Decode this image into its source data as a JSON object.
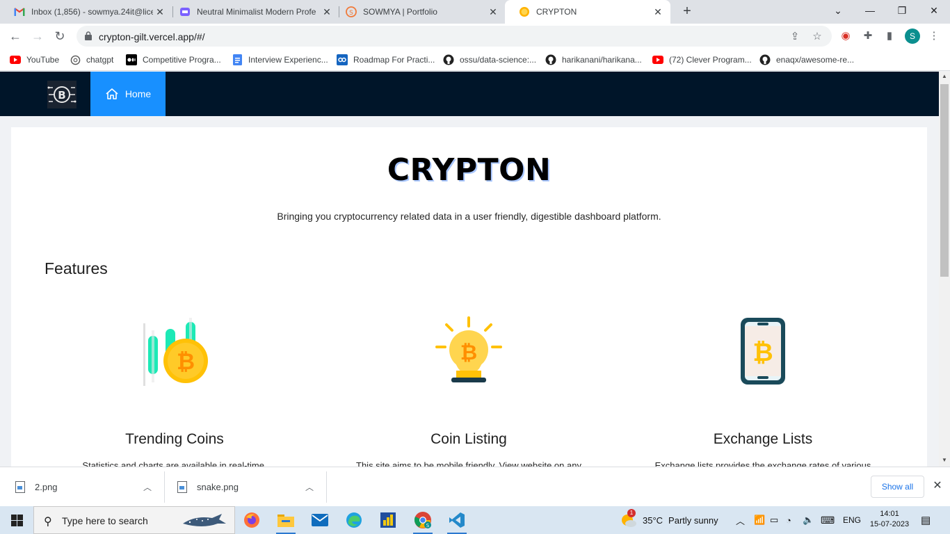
{
  "browser": {
    "tabs": [
      {
        "title": "Inbox (1,856) - sowmya.24it@lice",
        "icon": "gmail-icon",
        "active": false
      },
      {
        "title": "Neutral Minimalist Modern Profe",
        "icon": "document-icon",
        "active": false
      },
      {
        "title": "SOWMYA | Portfolio",
        "icon": "portfolio-icon",
        "active": false
      },
      {
        "title": "CRYPTON",
        "icon": "coin-icon",
        "active": true
      }
    ],
    "url": "crypton-gilt.vercel.app/#/",
    "profile_initial": "S",
    "bookmarks": [
      {
        "label": "YouTube",
        "icon": "youtube-icon"
      },
      {
        "label": "chatgpt",
        "icon": "openai-icon"
      },
      {
        "label": "Competitive Progra...",
        "icon": "medium-icon"
      },
      {
        "label": "Interview Experienc...",
        "icon": "docs-icon"
      },
      {
        "label": "Roadmap For Practi...",
        "icon": "roadmap-icon"
      },
      {
        "label": "ossu/data-science:...",
        "icon": "github-icon"
      },
      {
        "label": "harikanani/harikana...",
        "icon": "github-icon"
      },
      {
        "label": "(72) Clever Program...",
        "icon": "youtube-icon"
      },
      {
        "label": "enaqx/awesome-re...",
        "icon": "github-icon"
      }
    ]
  },
  "site": {
    "nav_home": "Home",
    "title": "CRYPTON",
    "subtitle": "Bringing you cryptocurrency related data in a user friendly, digestible dashboard platform.",
    "features_heading": "Features",
    "features": [
      {
        "title": "Trending Coins",
        "desc": "Statistics and charts are available in real-time.",
        "icon": "candlestick-coin-icon"
      },
      {
        "title": "Coin Listing",
        "desc": "This site aims to be mobile friendly. View website on any",
        "icon": "bitcoin-lightbulb-icon"
      },
      {
        "title": "Exchange Lists",
        "desc": "Exchange lists provides the exchange rates of various",
        "icon": "bitcoin-phone-icon"
      }
    ]
  },
  "downloads": {
    "items": [
      "2.png",
      "snake.png"
    ],
    "show_all": "Show all"
  },
  "taskbar": {
    "search_placeholder": "Type here to search",
    "weather_temp": "35°C",
    "weather_desc": "Partly sunny",
    "weather_badge": "1",
    "language": "ENG",
    "time": "14:01",
    "date": "15-07-2023"
  },
  "colors": {
    "nav_bg": "#001529",
    "nav_active": "#1890ff",
    "coin_yellow": "#ffc107",
    "teal": "#1de9b6"
  }
}
